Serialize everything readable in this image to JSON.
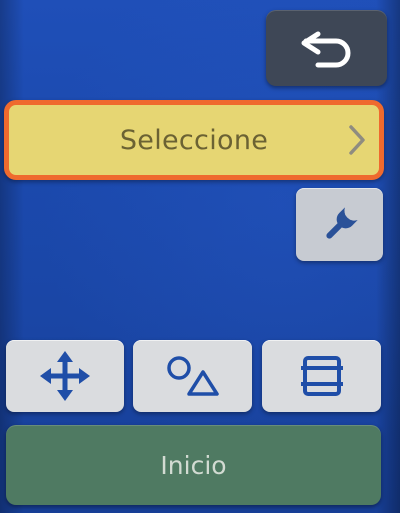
{
  "toolbar": {
    "back_icon": "undo-arrow-icon",
    "tool_icon": "wrench-icon"
  },
  "selector": {
    "label": "Seleccione",
    "chevron_icon": "chevron-right-icon",
    "highlight_color": "#ef6a2e",
    "background_color": "#e6d673"
  },
  "actions": [
    {
      "icon": "move-arrows-icon"
    },
    {
      "icon": "circle-triangle-icon"
    },
    {
      "icon": "frame-layout-icon"
    }
  ],
  "home": {
    "label": "Inicio",
    "color": "#4f7a62"
  },
  "colors": {
    "screen_background": "#1b49ad",
    "icon_blue": "#1f4ea8"
  }
}
